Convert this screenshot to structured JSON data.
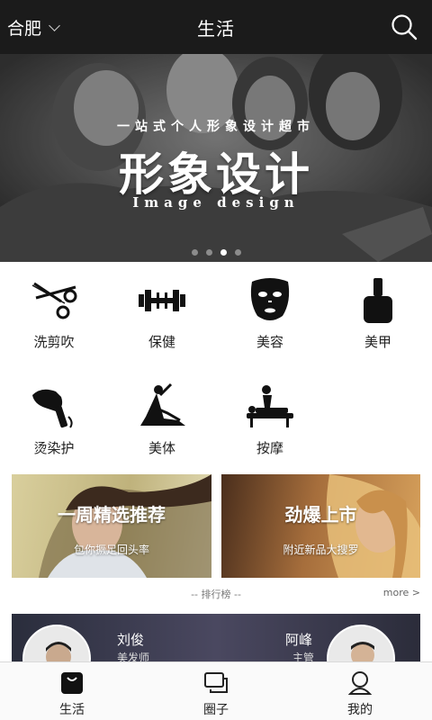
{
  "header": {
    "city": "合肥",
    "title": "生活",
    "icons": {
      "city_dropdown": "chevron-down-icon",
      "search": "search-icon"
    }
  },
  "banner": {
    "subtitle": "一站式个人形象设计超市",
    "title": "形象设计",
    "english": "Image design",
    "dots_total": 4,
    "active_dot": 3
  },
  "services": [
    {
      "label": "洗剪吹",
      "icon": "scissors-icon"
    },
    {
      "label": "保健",
      "icon": "dumbbell-icon"
    },
    {
      "label": "美容",
      "icon": "face-mask-icon"
    },
    {
      "label": "美甲",
      "icon": "nail-polish-icon"
    },
    {
      "label": "烫染护",
      "icon": "hair-dryer-icon"
    },
    {
      "label": "美体",
      "icon": "yoga-icon"
    },
    {
      "label": "按摩",
      "icon": "massage-icon"
    }
  ],
  "promos": [
    {
      "title": "一周精选推荐",
      "subtitle": "包你撅足回头率"
    },
    {
      "title": "劲爆上市",
      "subtitle": "附近新品大搜罗"
    }
  ],
  "ranking": {
    "label": "-- 排行榜 --",
    "more": "more >",
    "people": [
      {
        "name": "刘俊",
        "role": "美发师"
      },
      {
        "name": "阿峰",
        "role": "主管"
      }
    ]
  },
  "nav": [
    {
      "label": "生活",
      "icon": "bag-icon",
      "active": true
    },
    {
      "label": "圈子",
      "icon": "chat-icon",
      "active": false
    },
    {
      "label": "我的",
      "icon": "user-icon",
      "active": false
    }
  ],
  "colors": {
    "header_bg": "#1b1b1b",
    "promo_left": "#c9bf8e",
    "promo_right": "#8a5a32",
    "rank_bg": "#3a3a4e"
  }
}
